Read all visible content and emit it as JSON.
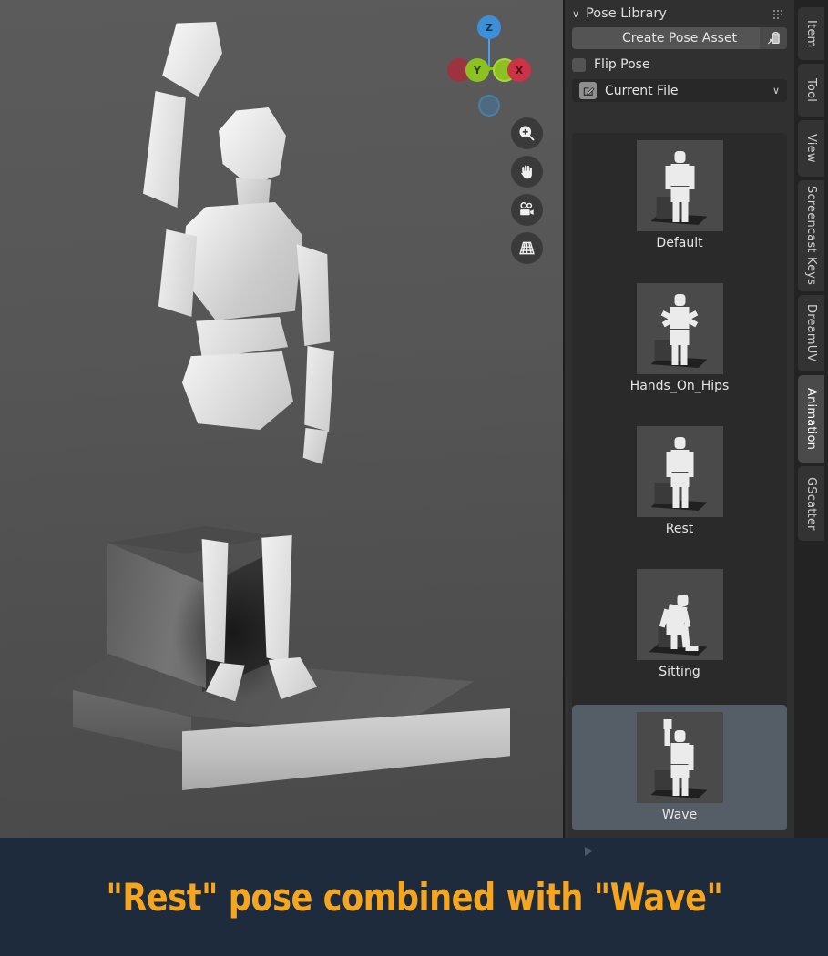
{
  "viewport": {
    "name": "3D Viewport",
    "gizmo": {
      "axis_labels": [
        "Z",
        "Y",
        "X"
      ],
      "colors": {
        "z": "#3d8fd8",
        "y": "#8dc122",
        "x": "#cc3344"
      }
    },
    "buttons": [
      {
        "name": "zoom-icon",
        "glyph": "⊕",
        "label": "Zoom"
      },
      {
        "name": "pan-hand-icon",
        "glyph": "✋",
        "label": "Move View"
      },
      {
        "name": "camera-icon",
        "glyph": "▣",
        "label": "Camera View"
      },
      {
        "name": "grid-perspective-icon",
        "glyph": "▦",
        "label": "Toggle Perspective/Ortho"
      }
    ]
  },
  "sidebar": {
    "panel": {
      "title": "Pose Library",
      "collapse_chevron": "∨",
      "grip_icon": "drag-grip"
    },
    "create_pose_asset": {
      "label": "Create Pose Asset",
      "icon": "paste-clipboard-icon"
    },
    "flip_pose": {
      "label": "Flip Pose",
      "checked": false
    },
    "library_source": {
      "value": "Current File",
      "icon": "edit-pencil-icon",
      "caret": "∨"
    },
    "assets": [
      {
        "label": "Default",
        "pose": "default",
        "selected": false
      },
      {
        "label": "Hands_On_Hips",
        "pose": "hips",
        "selected": false
      },
      {
        "label": "Rest",
        "pose": "rest",
        "selected": false
      },
      {
        "label": "Sitting",
        "pose": "sitting",
        "selected": false
      },
      {
        "label": "Wave",
        "pose": "wave",
        "selected": true
      }
    ]
  },
  "tabs": [
    {
      "label": "Item",
      "active": false
    },
    {
      "label": "Tool",
      "active": false
    },
    {
      "label": "View",
      "active": false
    },
    {
      "label": "Screencast Keys",
      "active": false
    },
    {
      "label": "DreamUV",
      "active": false
    },
    {
      "label": "Animation",
      "active": true
    },
    {
      "label": "GScatter",
      "active": false
    }
  ],
  "caption": {
    "text": "\"Rest\" pose combined with \"Wave\"",
    "text_color": "#f5a51e",
    "background_color": "#1e2b3c"
  }
}
